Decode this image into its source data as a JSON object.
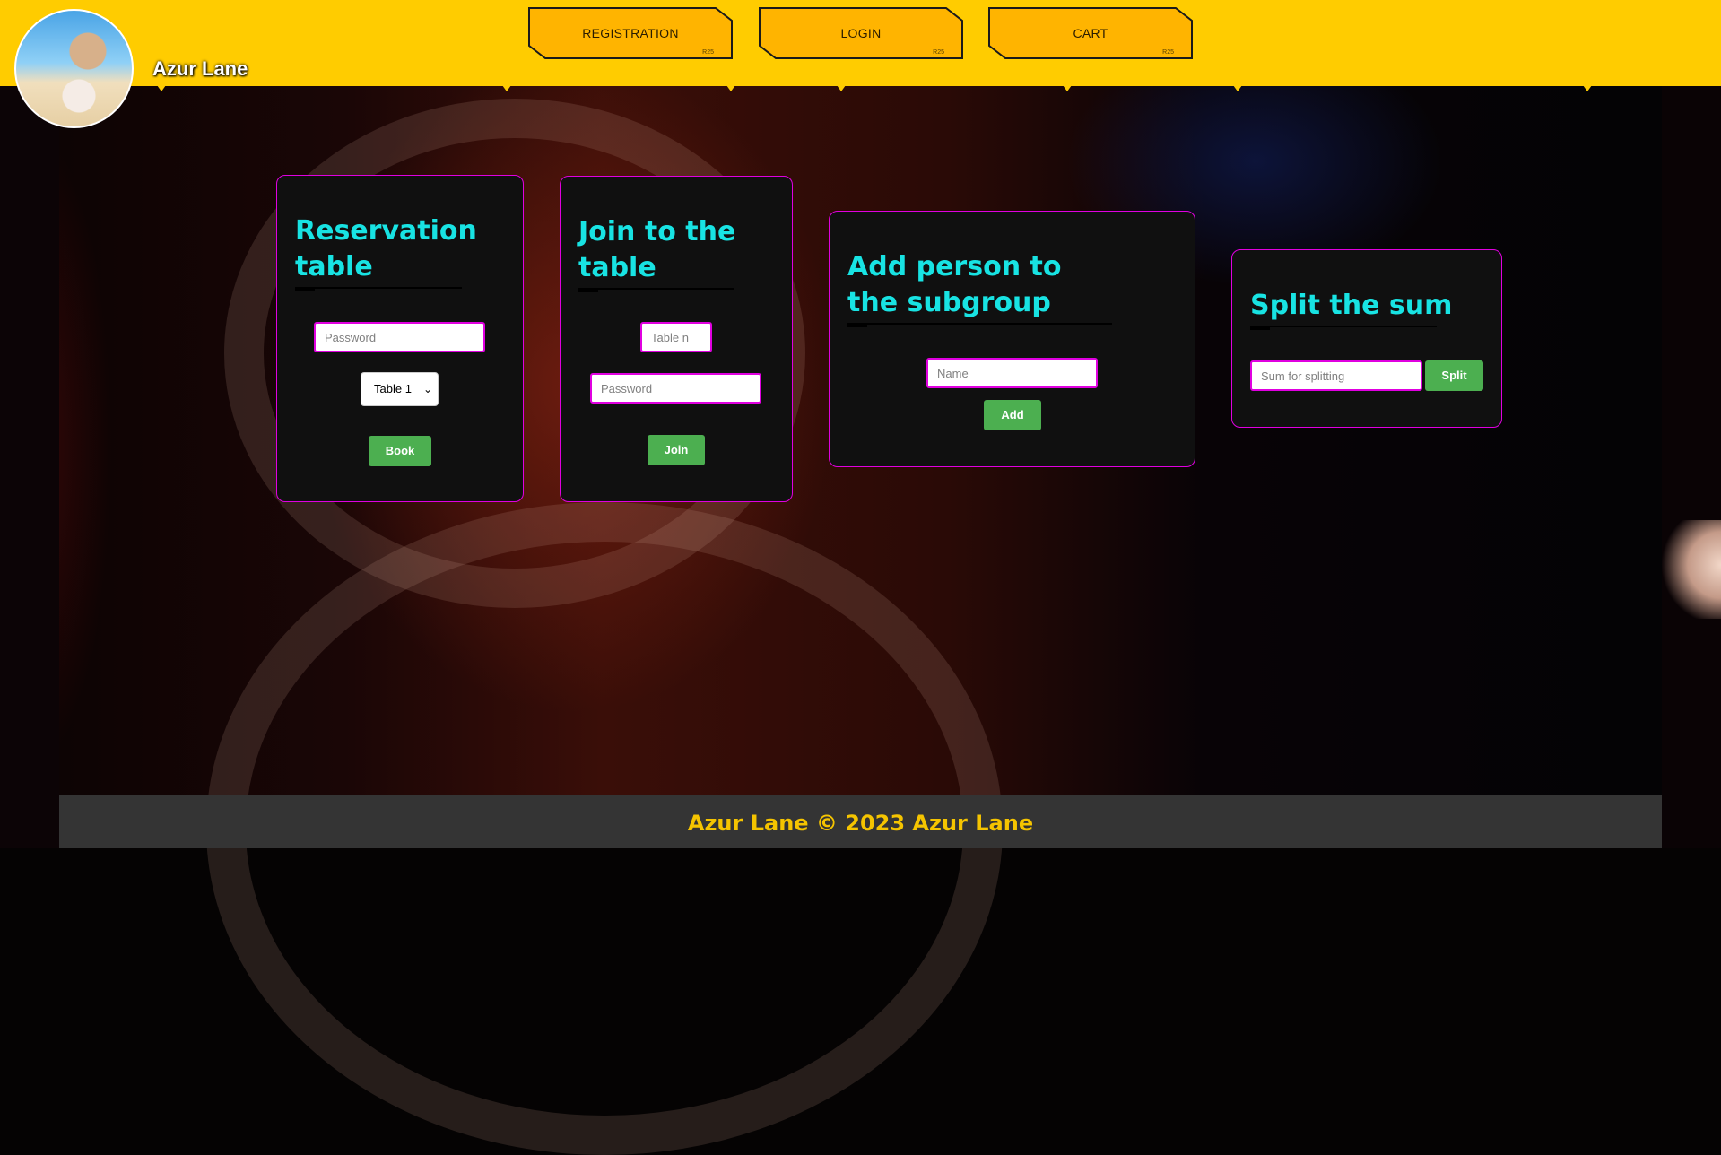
{
  "header": {
    "brand": "Azur Lane",
    "nav": [
      {
        "label": "REGISTRATION",
        "tag": "R25"
      },
      {
        "label": "LOGIN",
        "tag": "R25"
      },
      {
        "label": "CART",
        "tag": "R25"
      }
    ]
  },
  "cards": {
    "reservation": {
      "title": "Reservation table",
      "password_placeholder": "Password",
      "table_select_value": "Table 1",
      "button": "Book"
    },
    "join": {
      "title": "Join to the table",
      "table_placeholder": "Table n",
      "password_placeholder": "Password",
      "button": "Join"
    },
    "add_person": {
      "title": "Add person to the subgroup",
      "name_placeholder": "Name",
      "button": "Add"
    },
    "split": {
      "title": "Split the sum",
      "sum_placeholder": "Sum for splitting",
      "button": "Split"
    }
  },
  "footer": {
    "text": "Azur Lane © 2023 Azur Lane"
  },
  "colors": {
    "header_bg": "#ffcc00",
    "nav_button_bg": "#ffb400",
    "card_border": "#e000e0",
    "title_cyan": "#18e3e3",
    "button_green": "#4caf50",
    "footer_text": "#f5c400"
  }
}
